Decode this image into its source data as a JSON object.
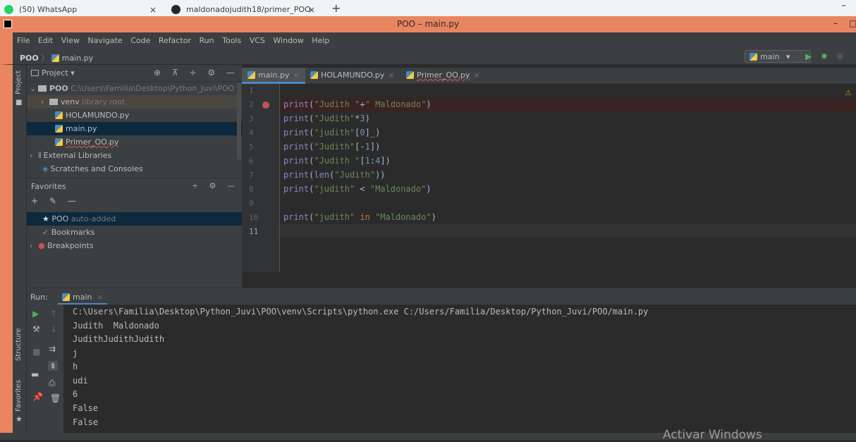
{
  "browser": {
    "tabs": [
      {
        "label": "(50) WhatsApp"
      },
      {
        "label": "maldonadojudith18/primer_POO"
      }
    ],
    "close": "×",
    "new_tab": "+",
    "minimize": "–"
  },
  "window": {
    "title": "POO – main.py",
    "min": "–",
    "max": "□"
  },
  "menu": [
    "File",
    "Edit",
    "View",
    "Navigate",
    "Code",
    "Refactor",
    "Run",
    "Tools",
    "VCS",
    "Window",
    "Help"
  ],
  "breadcrumb": {
    "project": "POO",
    "separator": "〉",
    "file": "main.py"
  },
  "run_config": {
    "label": "main",
    "caret": "▾"
  },
  "side_labels": {
    "project": "Project",
    "structure": "Structure",
    "favorites": "Favorites"
  },
  "project_pane": {
    "header": "Project",
    "caret": "▾",
    "icons": "⊕ ⊼ ÷ ⚙ —",
    "tree": [
      {
        "name": "POO",
        "detail": "C:\\Users\\Familia\\Desktop\\Python_Juvi\\POO"
      },
      {
        "name": "venv",
        "detail": "library root"
      },
      {
        "name": "HOLAMUNDO.py",
        "detail": ""
      },
      {
        "name": "main.py",
        "detail": ""
      },
      {
        "name": "Primer_OO.py",
        "detail": ""
      },
      {
        "name": "External Libraries",
        "detail": ""
      },
      {
        "name": "Scratches and Consoles",
        "detail": ""
      }
    ]
  },
  "favorites_pane": {
    "header": "Favorites",
    "icons": "÷ ⚙ —",
    "toolbar": "+ ✎ —",
    "items": [
      {
        "name": "POO",
        "detail": "auto-added"
      },
      {
        "name": "Bookmarks",
        "detail": ""
      },
      {
        "name": "Breakpoints",
        "detail": ""
      }
    ]
  },
  "editor": {
    "tabs": [
      {
        "label": "main.py",
        "active": true
      },
      {
        "label": "HOLAMUNDO.py",
        "active": false
      },
      {
        "label": "Primer_OO.py",
        "active": false
      }
    ],
    "tab_close": "×",
    "line_numbers": [
      "1",
      "2",
      "3",
      "4",
      "5",
      "6",
      "7",
      "8",
      "9",
      "10",
      "11"
    ],
    "warning_icon": "⚠",
    "lines": [
      "",
      "print(\"Judith \"+\" Maldonado\")",
      "print(\"Judith\"*3)",
      "print(\"judith\"[0]_)",
      "print(\"Judith\"[-1])",
      "print(\"Judith \"[1:4])",
      "print(len(\"Judith\"))",
      "print(\"judith\" < \"Maldonado\")",
      "",
      "print(\"judith\" in \"Maldonado\")",
      ""
    ]
  },
  "run_panel": {
    "label": "Run:",
    "tab": "main",
    "tab_close": "×",
    "output": [
      "C:\\Users\\Familia\\Desktop\\Python_Juvi\\POO\\venv\\Scripts\\python.exe C:/Users/Familia/Desktop/Python_Juvi/POO/main.py",
      "Judith  Maldonado",
      "JudithJudithJudith",
      "j",
      "h",
      "udi",
      "6",
      "False",
      "False"
    ]
  },
  "watermark": "Activar Windows",
  "colors": {
    "accent": "#e9855f",
    "selection": "#0d293e",
    "tab_underline": "#4a88c7",
    "breakpoint": "#c75450"
  }
}
